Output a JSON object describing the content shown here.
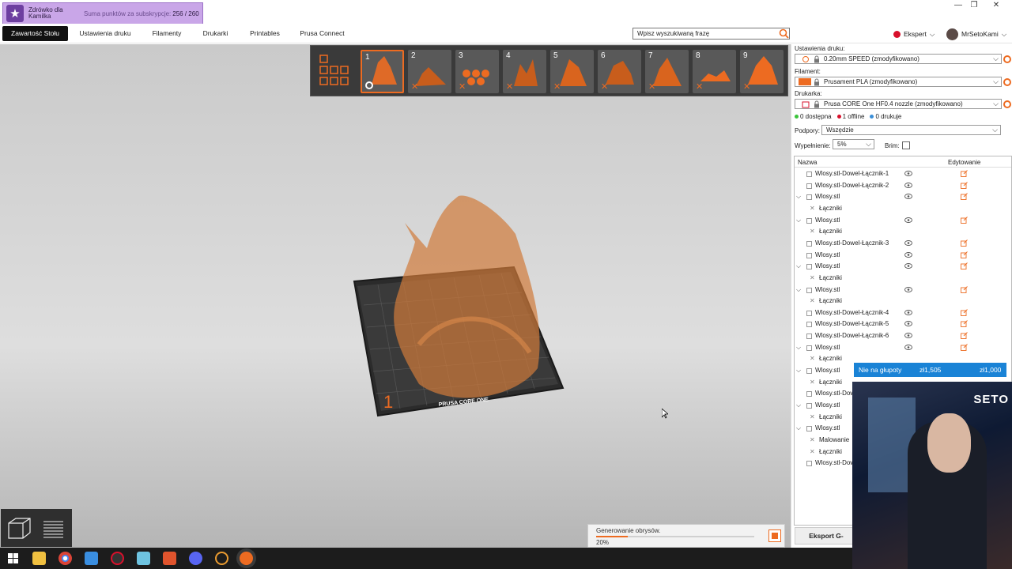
{
  "titlebar": {
    "subscription": {
      "name": "Zdrówko dla Kamilka",
      "points_label": "Suma punktów za subskrypcje:",
      "points_value": "256 / 260"
    },
    "window_controls": {
      "minimize": "—",
      "restore": "❐",
      "close": "✕"
    }
  },
  "menu": {
    "tabs": [
      {
        "label": "Zawartość Stołu",
        "active": true
      },
      {
        "label": "Ustawienia druku"
      },
      {
        "label": "Filamenty"
      },
      {
        "label": "Drukarki"
      },
      {
        "label": "Printables"
      },
      {
        "label": "Prusa Connect"
      }
    ],
    "search_placeholder": "Wpisz wyszukiwaną frazę",
    "mode_label": "Ekspert",
    "user_name": "MrSetoKami"
  },
  "plates": [
    {
      "num": "1",
      "selected": true,
      "status": "o"
    },
    {
      "num": "2",
      "status": "x"
    },
    {
      "num": "3",
      "status": "x"
    },
    {
      "num": "4",
      "status": "x"
    },
    {
      "num": "5",
      "status": "x"
    },
    {
      "num": "6",
      "status": "x"
    },
    {
      "num": "7",
      "status": "x"
    },
    {
      "num": "8",
      "status": "x"
    },
    {
      "num": "9",
      "status": "x"
    }
  ],
  "bed": {
    "brand": "PRUSA CORE ONE",
    "plate_number": "1"
  },
  "progress": {
    "label": "Generowanie obrysów.",
    "percent_label": "20%",
    "fraction": 0.2
  },
  "panel": {
    "print_settings_label": "Ustawienia druku:",
    "print_settings_value": "0.20mm SPEED (zmodyfikowano)",
    "filament_label": "Filament:",
    "filament_value": "Prusament PLA (zmodyfikowano)",
    "filament_color": "#ed6b21",
    "printer_label": "Drukarka:",
    "printer_value": "Prusa CORE One HF0.4 nozzle (zmodyfikowano)",
    "status": {
      "available": "0 dostępna",
      "offline": "1 offline",
      "printing": "0 drukuje"
    },
    "supports_label": "Podpory:",
    "supports_value": "Wszędzie",
    "infill_label": "Wypełnienie:",
    "infill_value": "5%",
    "brim_label": "Brim:",
    "list_header_name": "Nazwa",
    "list_header_edit": "Edytowanie",
    "objects": [
      {
        "name": "Wlosy.stl-Dowel-Łącznik-1",
        "type": "obj",
        "eye": true
      },
      {
        "name": "Wlosy.stl-Dowel-Łącznik-2",
        "type": "obj",
        "eye": true
      },
      {
        "name": "Wlosy.stl",
        "type": "obj",
        "expand": true,
        "eye": true
      },
      {
        "name": "Łączniki",
        "type": "child"
      },
      {
        "name": "Wlosy.stl",
        "type": "obj",
        "expand": true,
        "eye": true
      },
      {
        "name": "Łączniki",
        "type": "child"
      },
      {
        "name": "Wlosy.stl-Dowel-Łącznik-3",
        "type": "obj",
        "eye": true
      },
      {
        "name": "Wlosy.stl",
        "type": "obj",
        "eye": true
      },
      {
        "name": "Wlosy.stl",
        "type": "obj",
        "expand": true,
        "eye": true
      },
      {
        "name": "Łączniki",
        "type": "child"
      },
      {
        "name": "Wlosy.stl",
        "type": "obj",
        "expand": true,
        "eye": true
      },
      {
        "name": "Łączniki",
        "type": "child"
      },
      {
        "name": "Wlosy.stl-Dowel-Łącznik-4",
        "type": "obj",
        "eye": true
      },
      {
        "name": "Wlosy.stl-Dowel-Łącznik-5",
        "type": "obj",
        "eye": true
      },
      {
        "name": "Wlosy.stl-Dowel-Łącznik-6",
        "type": "obj",
        "eye": true
      },
      {
        "name": "Wlosy.stl",
        "type": "obj",
        "expand": true,
        "eye": true
      },
      {
        "name": "Łączniki",
        "type": "child"
      },
      {
        "name": "Wlosy.stl",
        "type": "obj",
        "expand": true
      },
      {
        "name": "Łączniki",
        "type": "child"
      },
      {
        "name": "Wlosy.stl-Dow",
        "type": "obj"
      },
      {
        "name": "Wlosy.stl",
        "type": "obj",
        "expand": true
      },
      {
        "name": "Łączniki",
        "type": "child"
      },
      {
        "name": "Wlosy.stl",
        "type": "obj",
        "expand": true
      },
      {
        "name": "Malowanie",
        "type": "child"
      },
      {
        "name": "Łączniki",
        "type": "child"
      },
      {
        "name": "Wlosy.stl-Dow",
        "type": "obj"
      }
    ],
    "export_label": "Eksport G-"
  },
  "donation": {
    "label": "Nie na głupoty",
    "current": "zł1,505",
    "goal": "zł1,000"
  },
  "webcam_tag": "SETO"
}
